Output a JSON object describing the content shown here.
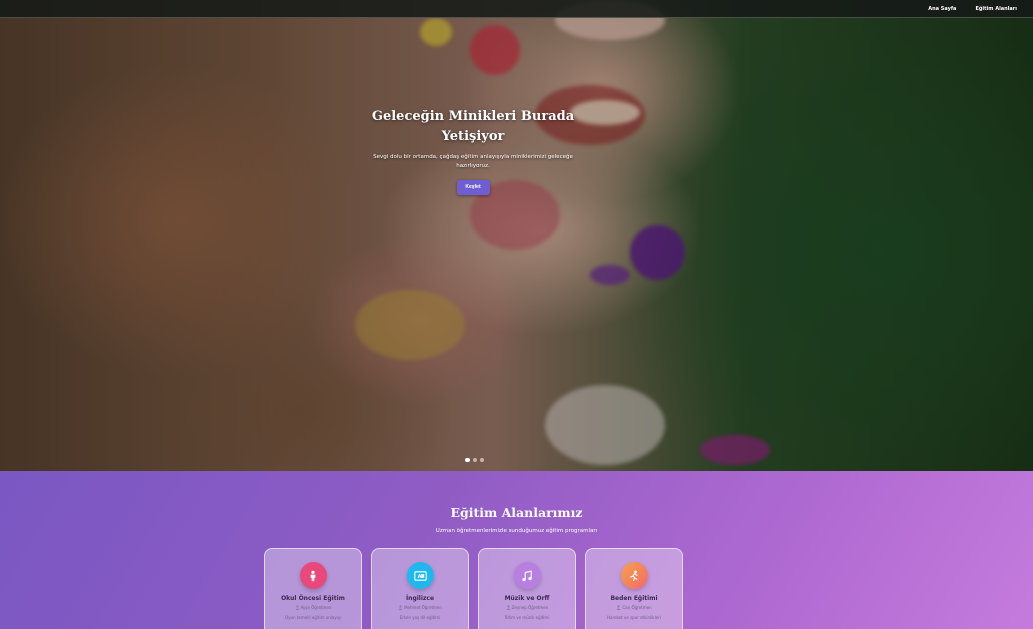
{
  "nav": {
    "links": [
      "Ana Sayfa",
      "Eğitim Alanları"
    ]
  },
  "hero": {
    "title_line1": "Geleceğin Minikleri Burada",
    "title_line2": "Yetişiyor",
    "subtitle_line1": "Sevgi dolu bir ortamda, çağdaş eğitim anlayışıyla miniklerimizi geleceğe",
    "subtitle_line2": "hazırlıyoruz.",
    "button_label": "Keşfet",
    "slide_count": 3,
    "active_slide": 1
  },
  "programs": {
    "title": "Eğitim Alanlarımız",
    "subtitle": "Uzman öğretmenlerimizle sunduğumuz eğitim programları",
    "cards": [
      {
        "title": "Okul Öncesi Eğitim",
        "teacher": "Ayşe Öğretmen",
        "desc": "Oyun temelli eğitim anlayışı",
        "icon": "child-icon",
        "color": "#e8497a"
      },
      {
        "title": "İngilizce",
        "teacher": "Mehmet Öğretmen",
        "desc": "Erken yaş dil eğitimi",
        "icon": "language-icon",
        "color": "#1fb8ee"
      },
      {
        "title": "Müzik ve Orff",
        "teacher": "Zeynep Öğretmen",
        "desc": "Ritim ve müzik eğitimi",
        "icon": "music-icon",
        "color": "#b67fe0"
      },
      {
        "title": "Beden Eğitimi",
        "teacher": "Can Öğretmen",
        "desc": "Hareket ve spor etkinlikleri",
        "icon": "running-icon",
        "color": "#f58a5a"
      }
    ]
  }
}
